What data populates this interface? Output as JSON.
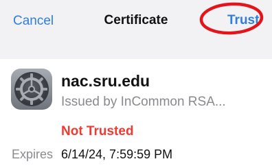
{
  "navbar": {
    "cancel_label": "Cancel",
    "title": "Certificate",
    "trust_label": "Trust",
    "accent_color": "#2f7de1",
    "annotation_color": "#e5141b"
  },
  "certificate": {
    "icon": "gear-certificate-icon",
    "name": "nac.sru.edu",
    "issuer": "Issued by InCommon RSA...",
    "status": "Not Trusted",
    "status_color": "#ee3a30",
    "expires_label": "Expires",
    "expires_value": "6/14/24, 7:59:59 PM"
  }
}
